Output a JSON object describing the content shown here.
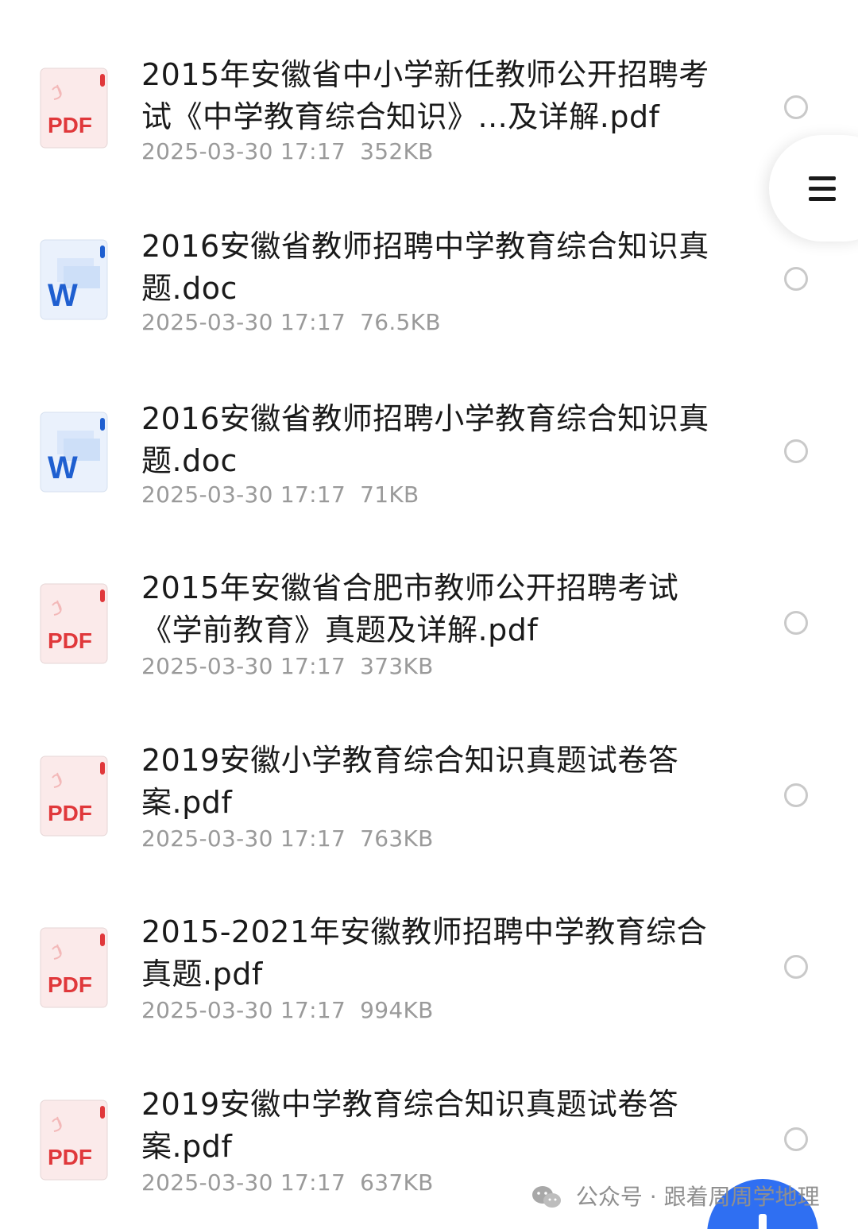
{
  "files": [
    {
      "type": "pdf",
      "name": "2015年安徽省中小学新任教师公开招聘考试《中学教育综合知识》...及详解.pdf",
      "date": "2025-03-30 17:17",
      "size": "352KB"
    },
    {
      "type": "doc",
      "name": "2016安徽省教师招聘中学教育综合知识真题.doc",
      "date": "2025-03-30 17:17",
      "size": "76.5KB"
    },
    {
      "type": "doc",
      "name": "2016安徽省教师招聘小学教育综合知识真题.doc",
      "date": "2025-03-30 17:17",
      "size": "71KB"
    },
    {
      "type": "pdf",
      "name": "2015年安徽省合肥市教师公开招聘考试《学前教育》真题及详解.pdf",
      "date": "2025-03-30 17:17",
      "size": "373KB"
    },
    {
      "type": "pdf",
      "name": "2019安徽小学教育综合知识真题试卷答案.pdf",
      "date": "2025-03-30 17:17",
      "size": "763KB"
    },
    {
      "type": "pdf",
      "name": "2015-2021年安徽教师招聘中学教育综合真题.pdf",
      "date": "2025-03-30 17:17",
      "size": "994KB"
    },
    {
      "type": "pdf",
      "name": "2019安徽中学教育综合知识真题试卷答案.pdf",
      "date": "2025-03-30 17:17",
      "size": "637KB"
    }
  ],
  "icons": {
    "pdf_label": "PDF",
    "doc_label": "W",
    "pdf_color": "#e0383b",
    "doc_color": "#1f5fd0",
    "menu": "menu-icon",
    "fab": "add-icon"
  },
  "watermark": {
    "text": "公众号 · 跟着周周学地理"
  },
  "colors": {
    "fab": "#2f6ff2",
    "radio_border": "#c9c9c9",
    "meta_text": "#9a9a9a"
  }
}
